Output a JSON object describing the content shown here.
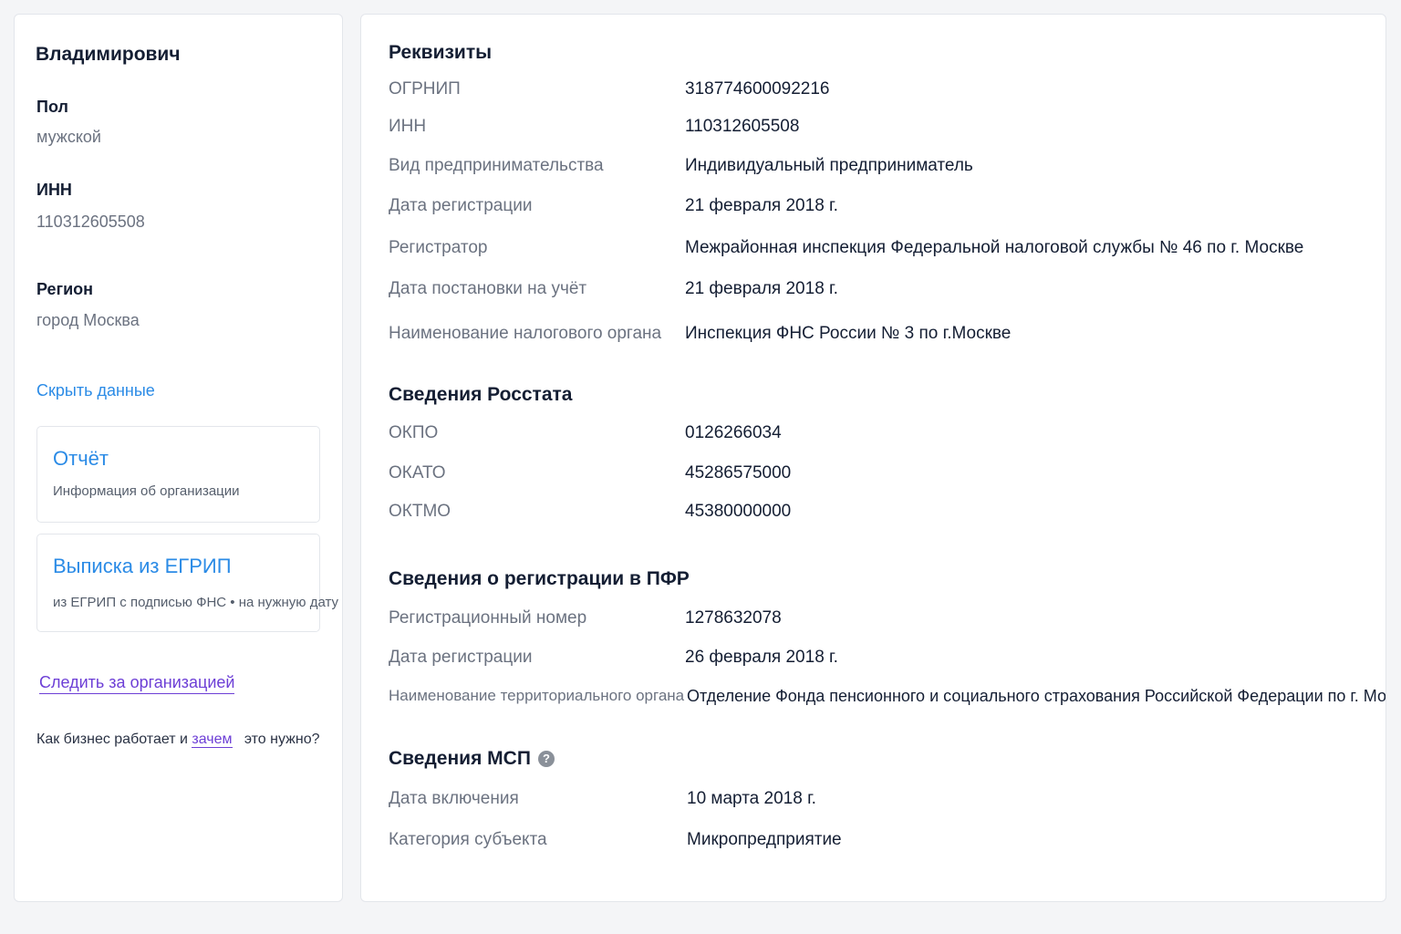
{
  "left": {
    "name": "Владимирович",
    "gender_label": "Пол",
    "gender_value": "мужской",
    "inn_label": "ИНН",
    "inn_value": "110312605508",
    "region_label": "Регион",
    "region_value": "город Москва",
    "hide_link": "Скрыть данные",
    "report_title": "Отчёт",
    "report_sub": "Информация об организации",
    "extract_title": "Выписка из ЕГРИП",
    "extract_sub": "из ЕГРИП с подписью ФНС • на нужную дату",
    "follow_link": "Следить за организацией",
    "why_prefix": "Как бизнес работает и",
    "why_link": "зачем",
    "why_suffix": "это нужно?"
  },
  "requisites": {
    "title": "Реквизиты",
    "rows": [
      {
        "label": "ОГРНИП",
        "value": "318774600092216"
      },
      {
        "label": "ИНН",
        "value": "110312605508"
      },
      {
        "label": "Вид предпринимательства",
        "value": "Индивидуальный предприниматель"
      },
      {
        "label": "Дата регистрации",
        "value": "21 февраля 2018 г."
      },
      {
        "label": "Регистратор",
        "value": "Межрайонная инспекция Федеральной налоговой службы № 46 по г. Москве"
      },
      {
        "label": "Дата постановки на учёт",
        "value": "21 февраля 2018 г."
      },
      {
        "label": "Наименование налогового органа",
        "value": "Инспекция ФНС России № 3 по г.Москве"
      }
    ]
  },
  "rosstat": {
    "title": "Сведения Росстата",
    "rows": [
      {
        "label": "ОКПО",
        "value": "0126266034"
      },
      {
        "label": "ОКАТО",
        "value": "45286575000"
      },
      {
        "label": "ОКТМО",
        "value": "45380000000"
      }
    ]
  },
  "pfr": {
    "title": "Сведения о регистрации в ПФР",
    "rows": [
      {
        "label": "Регистрационный номер",
        "value": "1278632078"
      },
      {
        "label": "Дата регистрации",
        "value": "26 февраля 2018 г."
      },
      {
        "label": "Наименование территориального органа",
        "value": "Отделение Фонда пенсионного и социального страхования Российской Федерации по г. Москве и Москве"
      }
    ]
  },
  "msp": {
    "title": "Сведения МСП",
    "help_icon": "?",
    "rows": [
      {
        "label": "Дата включения",
        "value": "10 марта 2018 г."
      },
      {
        "label": "Категория субъекта",
        "value": "Микропредприятие"
      }
    ]
  }
}
